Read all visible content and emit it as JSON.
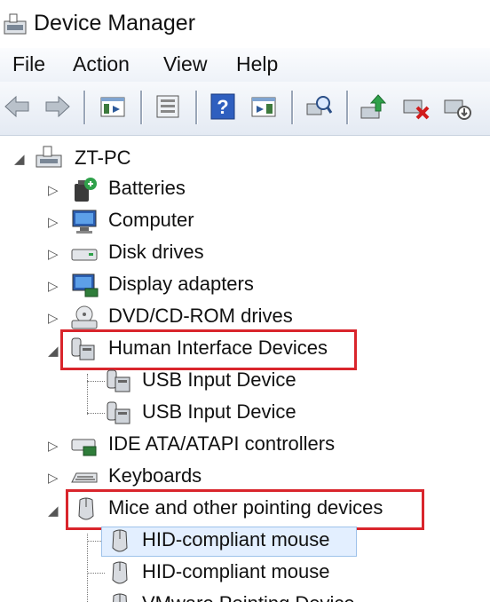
{
  "window": {
    "title": "Device Manager",
    "icon": "device-manager-icon"
  },
  "menu": [
    "File",
    "Action",
    "View",
    "Help"
  ],
  "toolbar": {
    "icons": [
      "back-icon",
      "forward-icon",
      "console-tree-icon",
      "properties-icon",
      "help-icon",
      "show-hide-icon",
      "scan-hardware-icon",
      "update-driver-icon",
      "uninstall-icon",
      "disable-icon"
    ]
  },
  "tree": {
    "root": "ZT-PC",
    "categories": [
      {
        "label": "Batteries",
        "icon": "battery-icon",
        "expanded": false
      },
      {
        "label": "Computer",
        "icon": "computer-icon",
        "expanded": false
      },
      {
        "label": "Disk drives",
        "icon": "disk-drive-icon",
        "expanded": false
      },
      {
        "label": "Display adapters",
        "icon": "display-adapter-icon",
        "expanded": false
      },
      {
        "label": "DVD/CD-ROM drives",
        "icon": "dvd-drive-icon",
        "expanded": false
      },
      {
        "label": "Human Interface Devices",
        "icon": "hid-icon",
        "expanded": true,
        "highlighted": true,
        "children": [
          "USB Input Device",
          "USB Input Device"
        ]
      },
      {
        "label": "IDE ATA/ATAPI controllers",
        "icon": "ide-controller-icon",
        "expanded": false
      },
      {
        "label": "Keyboards",
        "icon": "keyboard-icon",
        "expanded": false
      },
      {
        "label": "Mice and other pointing devices",
        "icon": "mouse-icon",
        "expanded": true,
        "highlighted": true,
        "children": [
          "HID-compliant mouse",
          "HID-compliant mouse",
          "VMware Pointing Device"
        ]
      }
    ],
    "selected": "HID-compliant mouse"
  },
  "colors": {
    "highlight_box": "#d9252c",
    "selection": "#e3efff"
  }
}
